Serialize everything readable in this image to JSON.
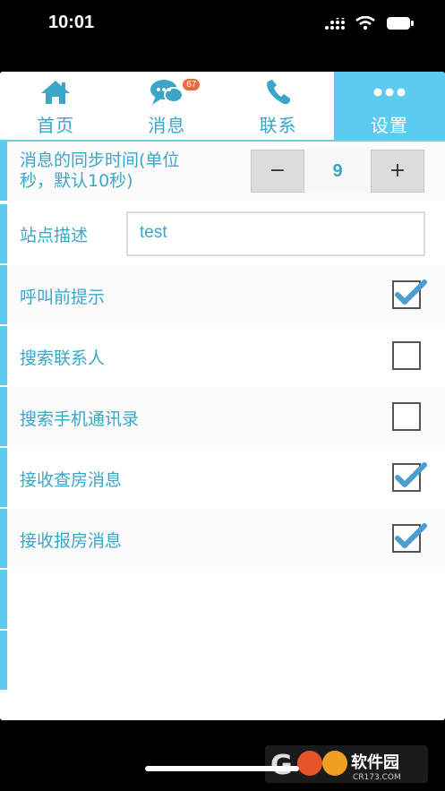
{
  "status": {
    "time": "10:01"
  },
  "tabs": [
    {
      "label": "首页",
      "icon": "home-icon"
    },
    {
      "label": "消息",
      "icon": "chat-icon",
      "badge": "67"
    },
    {
      "label": "联系",
      "icon": "phone-icon"
    },
    {
      "label": "设置",
      "icon": "more-icon",
      "active": true
    }
  ],
  "settings": {
    "sync_label": "消息的同步时间(单位秒，默认10秒)",
    "sync_label_line1": "消息的同步时间(单位",
    "sync_label_line2": "秒，默认10秒)",
    "sync_minus": "−",
    "sync_value": "9",
    "sync_plus": "+",
    "site_desc_label": "站点描述",
    "site_desc_value": "test",
    "toggles": [
      {
        "label": "呼叫前提示",
        "checked": true
      },
      {
        "label": "搜索联系人",
        "checked": false
      },
      {
        "label": "搜索手机通讯录",
        "checked": false
      },
      {
        "label": "接收查房消息",
        "checked": true
      },
      {
        "label": "接收报房消息",
        "checked": true
      }
    ]
  },
  "watermark": {
    "text": "软件园",
    "domain": "CR173.COM"
  },
  "colors": {
    "accent": "#5dcbef",
    "text": "#3aa6c8",
    "badge": "#ef6a3a"
  }
}
